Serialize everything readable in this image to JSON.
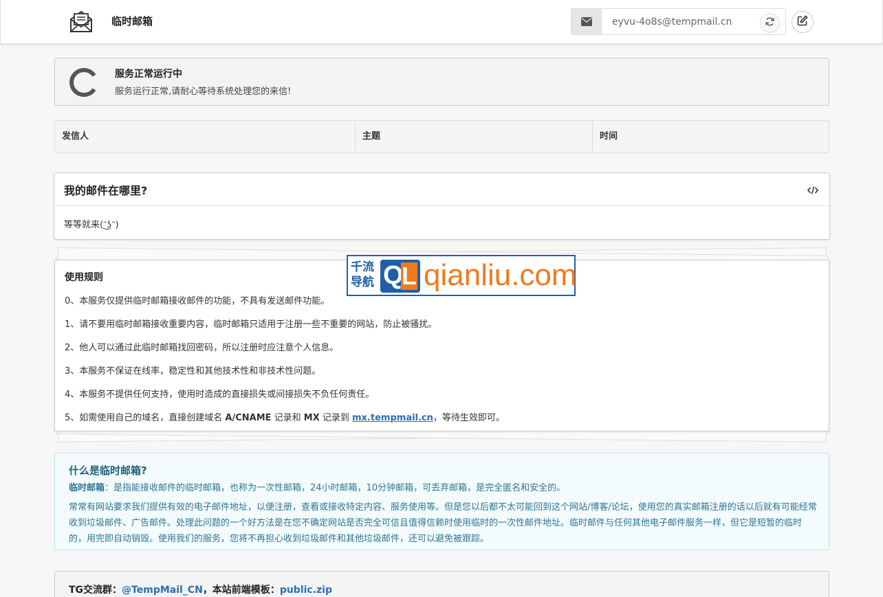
{
  "header": {
    "title": "临时邮箱",
    "logo_icon": "envelope-open-icon",
    "email_address": "eyvu-4o8s@tempmail.cn",
    "address_icon": "envelope-icon",
    "refresh_icon": "refresh-icon",
    "edit_icon": "edit-icon"
  },
  "status": {
    "title": "服务正常运行中",
    "text": "服务运行正常,请耐心等待系统处理您的来信!"
  },
  "mail_table": {
    "columns": [
      "发信人",
      "主题",
      "时间"
    ],
    "rows": []
  },
  "where_card": {
    "title": "我的邮件在哪里?",
    "body": "等等就来(ᵔ͜ʖᵔ)"
  },
  "rules": {
    "title": "使用规则",
    "items": [
      "0、本服务仅提供临时邮箱接收邮件的功能，不具有发送邮件功能。",
      "1、请不要用临时邮箱接收重要内容，临时邮箱只适用于注册一些不重要的网站，防止被骚扰。",
      "2、他人可以通过此临时邮箱找回密码，所以注册时应注意个人信息。",
      "3、本服务不保证在线率，稳定性和其他技术性和非技术性问题。",
      "4、本服务不提供任何支持，使用时造成的直接损失或间接损失不负任何责任。"
    ],
    "item5": {
      "prefix": "5、如需使用自己的域名，直接创建域名 ",
      "record1": "A/CNAME",
      "mid1": " 记录和 ",
      "record2": "MX",
      "mid2": " 记录到 ",
      "link": "mx.tempmail.cn",
      "suffix": "，等待生效即可。"
    }
  },
  "watermark": {
    "cn_line1": "千流",
    "cn_line2": "导航",
    "q": "Q",
    "l": "L",
    "domain": "qianliu.com"
  },
  "info": {
    "title": "什么是临时邮箱?",
    "term": "临时邮箱",
    "definition": "：是指能接收邮件的临时邮箱，也称为一次性邮箱，24小时邮箱，10分钟邮箱，可丢弃邮箱，是完全匿名和安全的。",
    "paragraph": "常常有网站要求我们提供有效的电子邮件地址，以便注册，查看或接收特定内容、服务使用等。但是您以后都不太可能回到这个网站/博客/论坛，使用您的真实邮箱注册的话以后就有可能经常收到垃圾邮件、广告邮件。处理此问题的一个好方法是在您不确定网站是否完全可信且值得信赖时使用临时的一次性邮件地址。临时邮件与任何其他电子邮件服务一样，但它是短暂的临时的，用完即自动销毁。使用我们的服务，您将不再担心收到垃圾邮件和其他垃圾邮件，还可以避免被跟踪。"
  },
  "footer": {
    "tg_label": "TG交流群：",
    "tg_link": "@TempMail_CN",
    "sep": "，本站前端模板：",
    "template_link": "public.zip"
  }
}
